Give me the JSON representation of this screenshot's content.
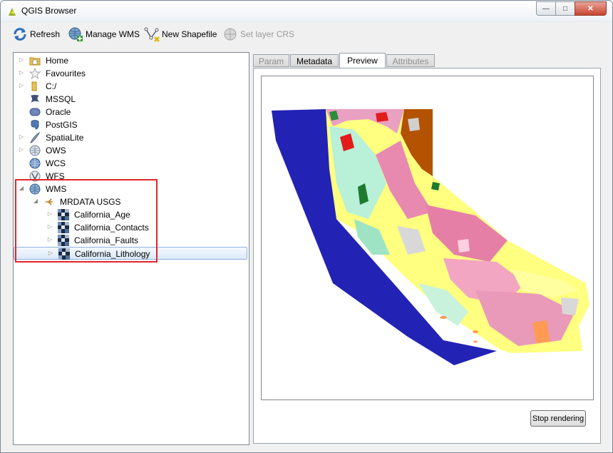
{
  "window": {
    "title": "QGIS Browser",
    "icon": "qgis-icon"
  },
  "window_controls": {
    "minimize": "—",
    "maximize": "□",
    "close": "✕"
  },
  "toolbar": {
    "refresh_label": "Refresh",
    "manage_wms_label": "Manage WMS",
    "new_shapefile_label": "New Shapefile",
    "set_layer_crs_label": "Set layer CRS"
  },
  "tree": {
    "items": [
      {
        "label": "Home",
        "icon": "home-folder-icon",
        "expanded": false
      },
      {
        "label": "Favourites",
        "icon": "star-icon",
        "expanded": false
      },
      {
        "label": "C:/",
        "icon": "folder-icon",
        "expanded": false
      },
      {
        "label": "MSSQL",
        "icon": "mssql-icon"
      },
      {
        "label": "Oracle",
        "icon": "oracle-icon"
      },
      {
        "label": "PostGIS",
        "icon": "postgis-icon"
      },
      {
        "label": "SpatiaLite",
        "icon": "spatialite-icon",
        "expanded": false
      },
      {
        "label": "OWS",
        "icon": "globe-icon",
        "expanded": false
      },
      {
        "label": "WCS",
        "icon": "globe-icon"
      },
      {
        "label": "WFS",
        "icon": "globe-icon"
      },
      {
        "label": "WMS",
        "icon": "globe-icon",
        "expanded": true
      },
      {
        "label": "MRDATA USGS",
        "icon": "connection-icon",
        "expanded": true
      },
      {
        "label": "California_Age",
        "icon": "raster-layer-icon",
        "expanded": false
      },
      {
        "label": "California_Contacts",
        "icon": "raster-layer-icon",
        "expanded": false
      },
      {
        "label": "California_Faults",
        "icon": "raster-layer-icon",
        "expanded": false
      },
      {
        "label": "California_Lithology",
        "icon": "raster-layer-icon",
        "expanded": false,
        "selected": true
      }
    ]
  },
  "tabs": [
    {
      "label": "Param",
      "state": "disabled"
    },
    {
      "label": "Metadata",
      "state": "normal"
    },
    {
      "label": "Preview",
      "state": "active"
    },
    {
      "label": "Attributes",
      "state": "disabled"
    }
  ],
  "preview": {
    "stop_button_label": "Stop rendering"
  },
  "colors": {
    "highlight": "#e0262b",
    "ocean": "#2222b4",
    "selection": "#dce9f8"
  }
}
